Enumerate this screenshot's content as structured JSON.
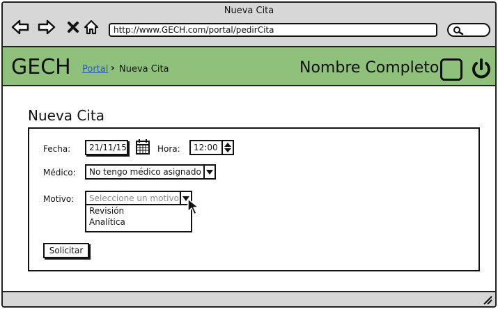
{
  "window": {
    "title": "Nueva Cita"
  },
  "browser": {
    "url": "http://www.GECH.com/portal/pedirCita",
    "icons": [
      "back-arrow-icon",
      "forward-arrow-icon",
      "close-icon",
      "home-icon",
      "search-icon"
    ]
  },
  "header": {
    "logo": "GECH",
    "breadcrumb": {
      "link": "Portal",
      "separator": "›",
      "current": "Nueva Cita"
    },
    "user_name": "Nombre Completo",
    "colors": {
      "header_bg": "#8fc07c",
      "link": "#2e5bbf"
    }
  },
  "form": {
    "title": "Nueva Cita",
    "fecha_label": "Fecha:",
    "fecha_value": "21/11/15",
    "hora_label": "Hora:",
    "hora_value": "12:00",
    "medico_label": "Médico:",
    "medico_value": "No tengo médico asignado",
    "motivo_label": "Motivo:",
    "motivo_placeholder": "Seleccione un motivo",
    "motivo_options": [
      "Revisión",
      "Analítica"
    ],
    "submit_label": "Solicitar"
  }
}
